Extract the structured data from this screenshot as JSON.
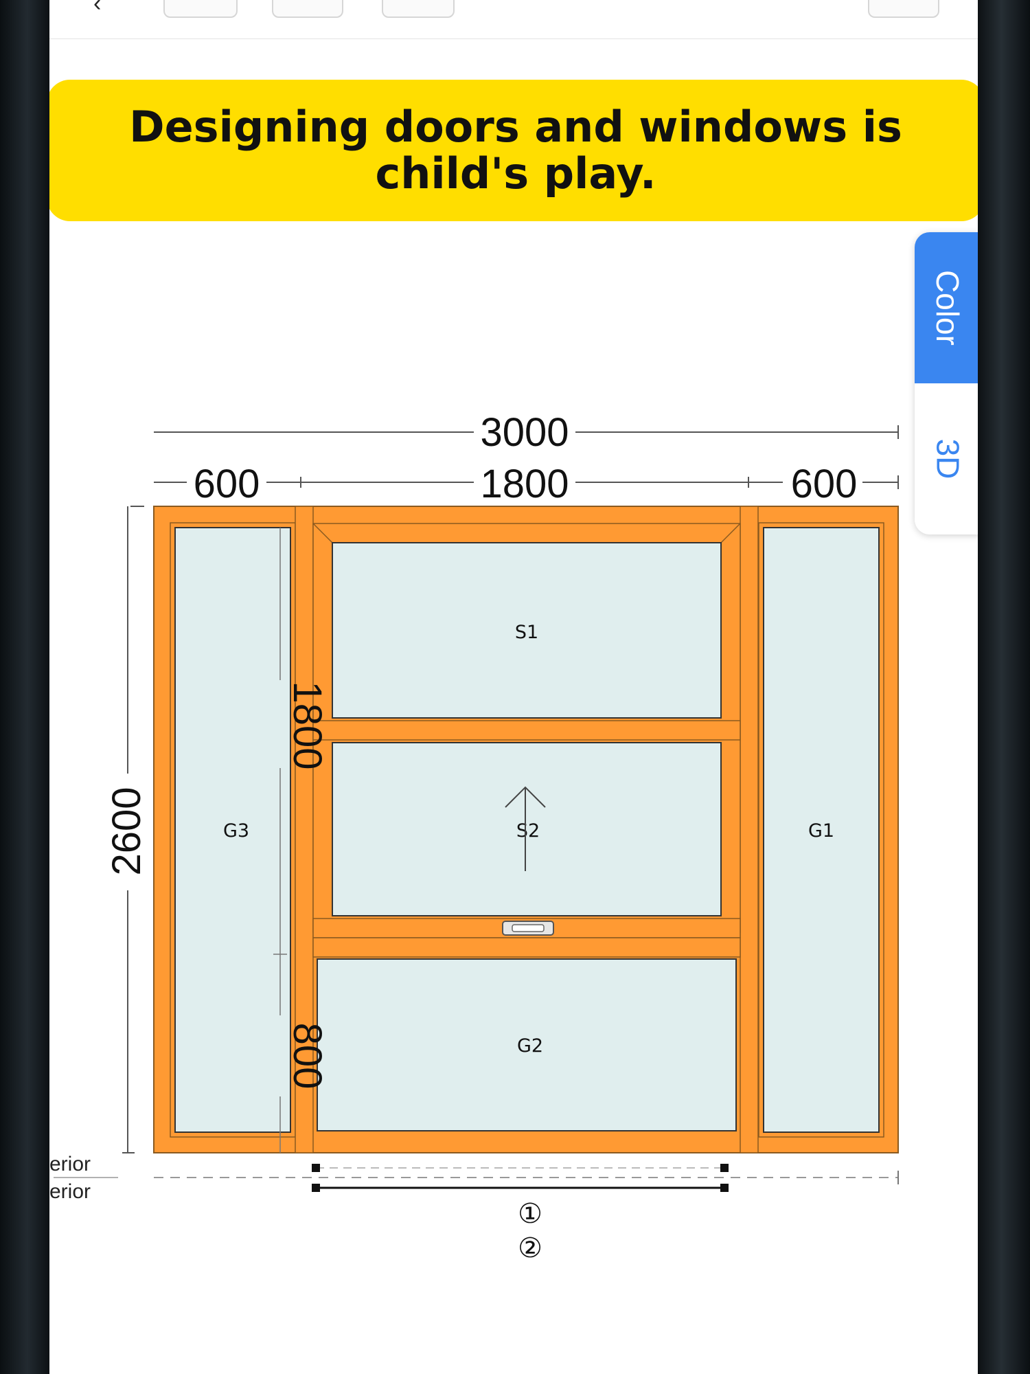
{
  "banner": {
    "text": "Designing doors and windows is child's play."
  },
  "tabs": {
    "color": "Color",
    "threeD": "3D"
  },
  "dimensions": {
    "total_width": "3000",
    "left_width": "600",
    "middle_width": "1800",
    "right_width": "600",
    "total_height": "2600",
    "upper_height": "1800",
    "lower_height": "800"
  },
  "panes": {
    "g3": "G3",
    "s1": "S1",
    "s2": "S2",
    "g2": "G2",
    "g1": "G1"
  },
  "side_labels": {
    "exterior": "erior",
    "interior": "erior"
  },
  "markers": {
    "one": "①",
    "two": "②"
  },
  "colors": {
    "frame": "#FF9A33",
    "glass": "#E0EEEE",
    "banner": "#FFDE00",
    "accent": "#3A86F0"
  }
}
